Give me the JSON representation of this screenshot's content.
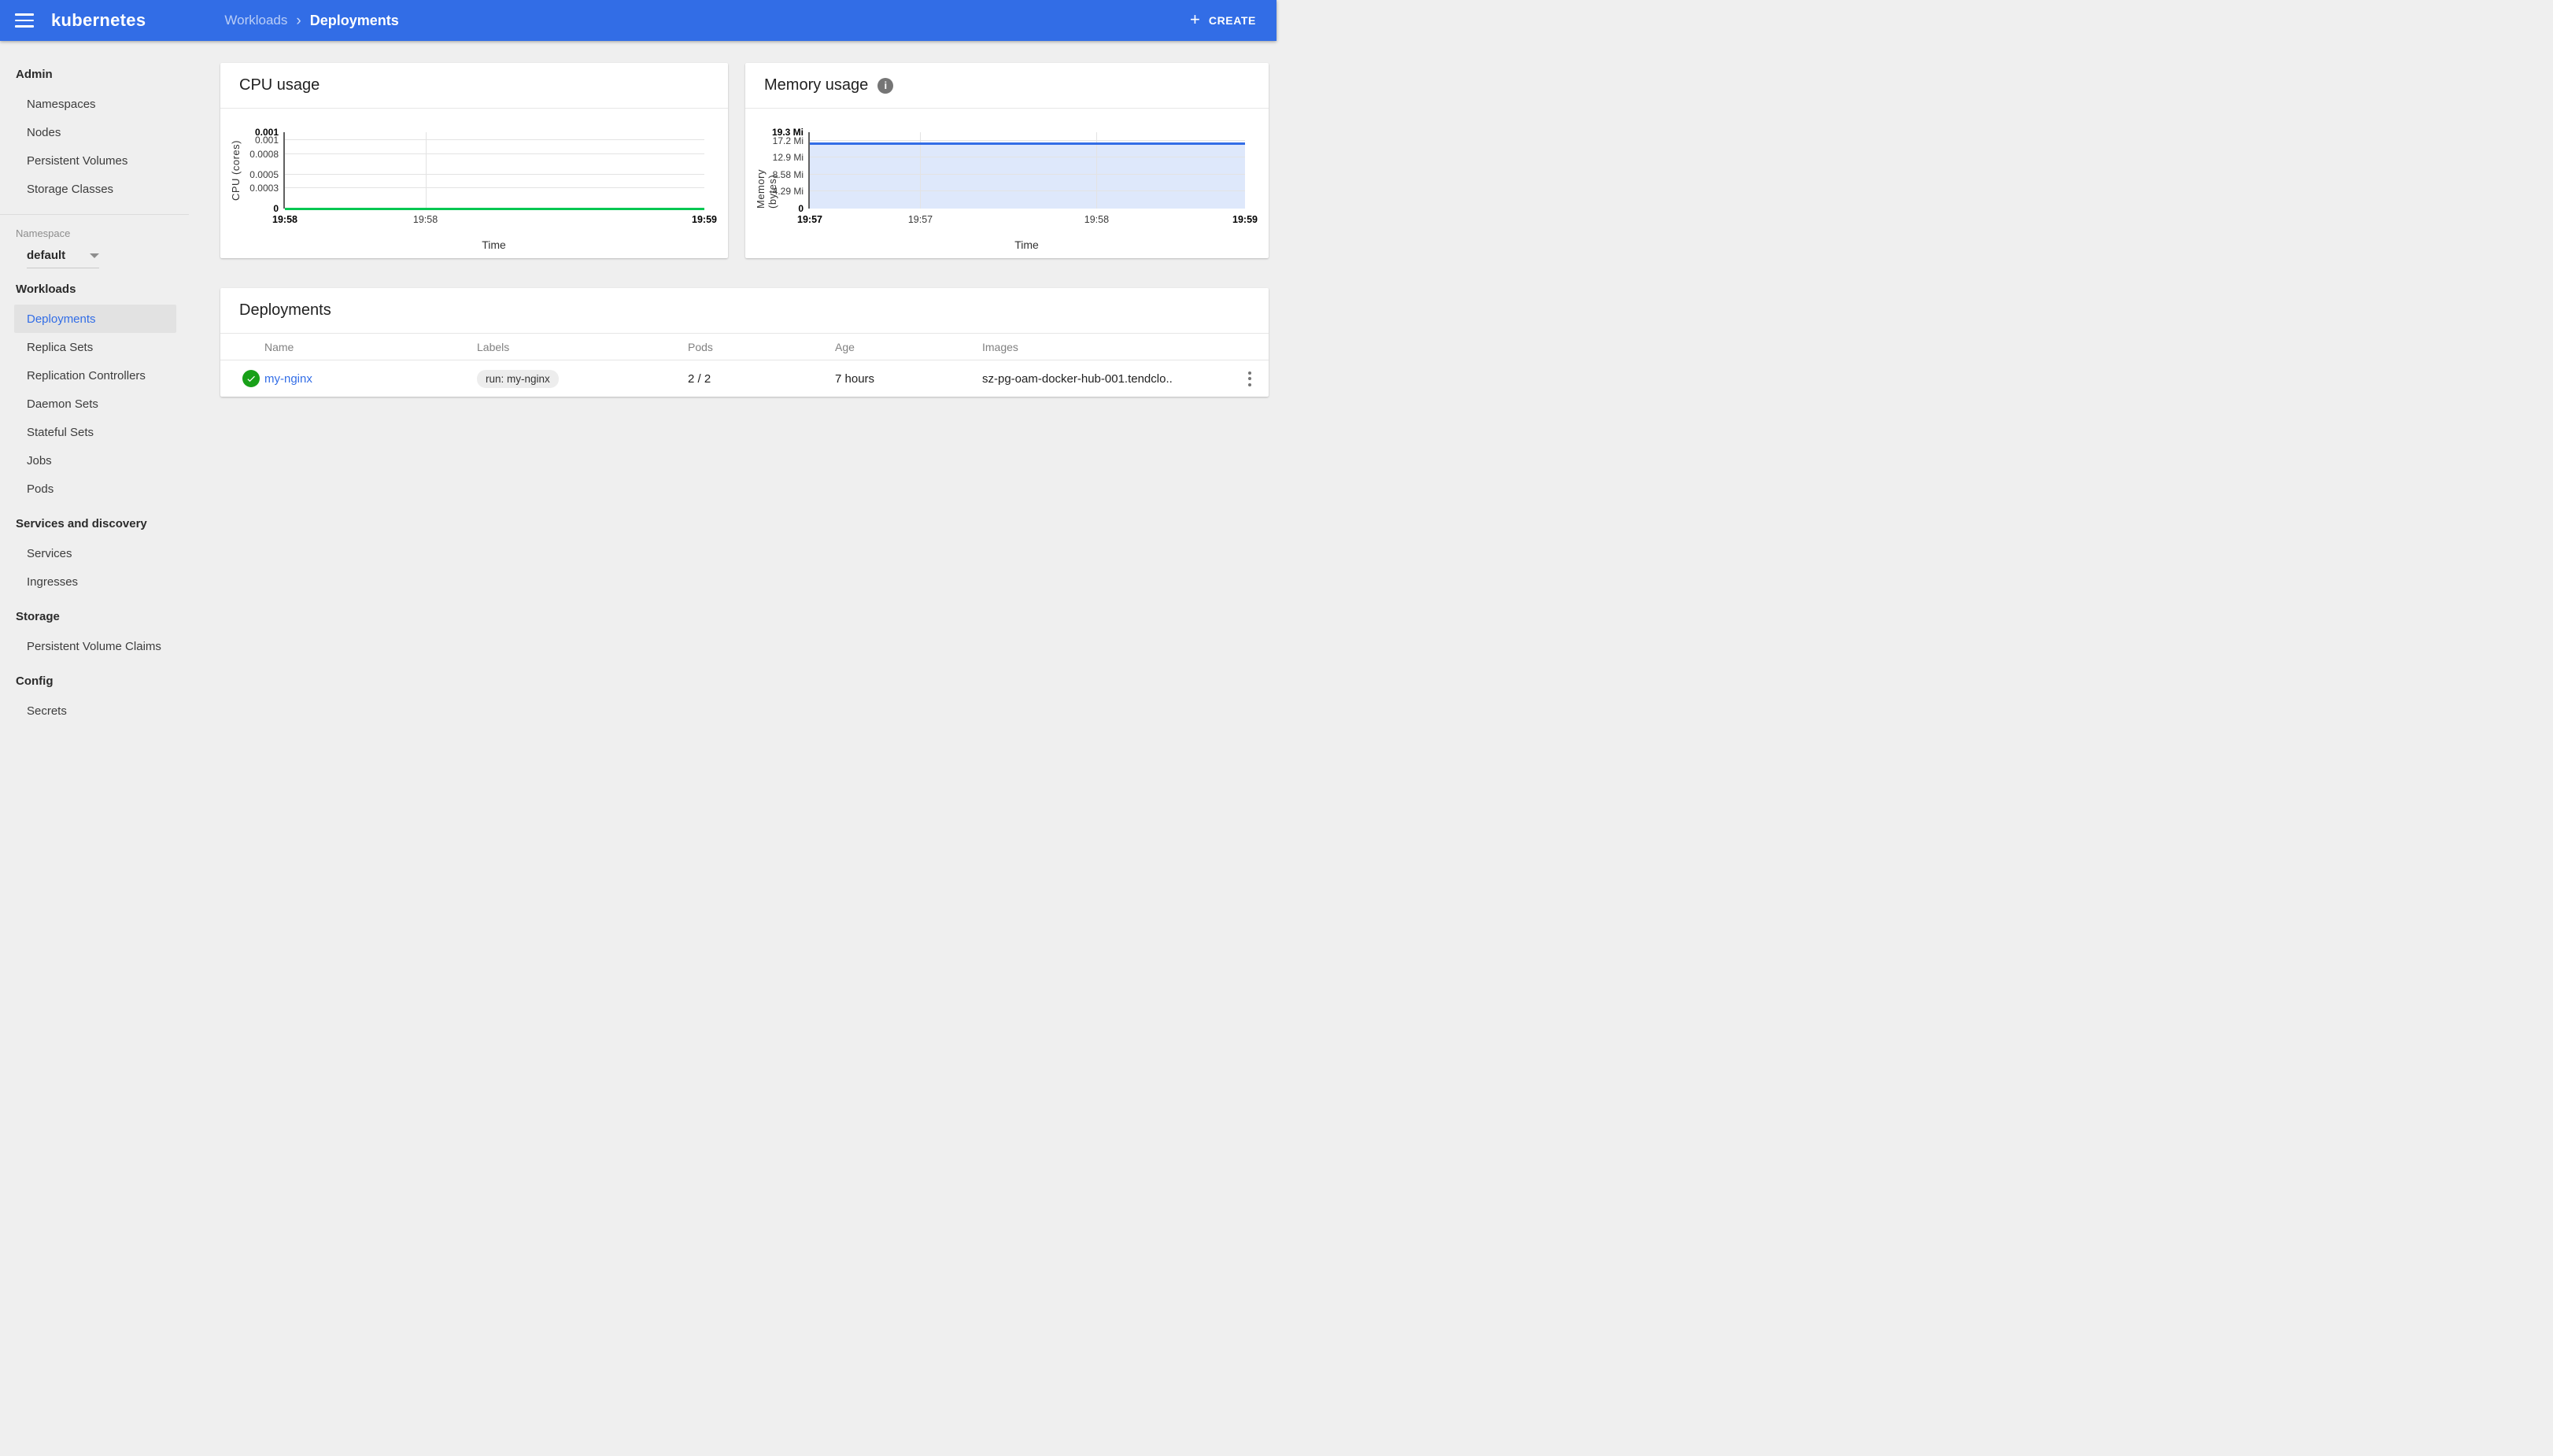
{
  "header": {
    "logo": "kubernetes",
    "breadcrumb": {
      "parent": "Workloads",
      "separator": "›",
      "current": "Deployments"
    },
    "create_label": "CREATE",
    "create_plus": "+",
    "accent_color": "#326de6"
  },
  "sidebar": {
    "sections": [
      {
        "title": "Admin",
        "items": [
          "Namespaces",
          "Nodes",
          "Persistent Volumes",
          "Storage Classes"
        ]
      },
      {
        "title": "Workloads",
        "items": [
          "Deployments",
          "Replica Sets",
          "Replication Controllers",
          "Daemon Sets",
          "Stateful Sets",
          "Jobs",
          "Pods"
        ],
        "selected": "Deployments"
      },
      {
        "title": "Services and discovery",
        "items": [
          "Services",
          "Ingresses"
        ]
      },
      {
        "title": "Storage",
        "items": [
          "Persistent Volume Claims"
        ]
      },
      {
        "title": "Config",
        "items": [
          "Secrets"
        ]
      }
    ],
    "namespace": {
      "label": "Namespace",
      "value": "default"
    }
  },
  "chart_data": [
    {
      "id": "cpu",
      "type": "line",
      "title": "CPU usage",
      "xlabel": "Time",
      "ylabel": "CPU (cores)",
      "ylim": [
        0,
        0.00112
      ],
      "grid": true,
      "y_ticks": [
        {
          "label": "0.001",
          "value": 0.00112,
          "bold": true,
          "gridline": false
        },
        {
          "label": "0.001",
          "value": 0.001,
          "bold": false,
          "gridline": true
        },
        {
          "label": "0.0008",
          "value": 0.0008,
          "bold": false,
          "gridline": true
        },
        {
          "label": "0.0005",
          "value": 0.0005,
          "bold": false,
          "gridline": true
        },
        {
          "label": "0.0003",
          "value": 0.0003,
          "bold": false,
          "gridline": true
        },
        {
          "label": "0",
          "value": 0,
          "bold": true,
          "gridline": false
        }
      ],
      "x_ticks": [
        {
          "label": "19:58",
          "pos": 0,
          "bold": true,
          "gridline": false
        },
        {
          "label": "19:58",
          "pos": 0.335,
          "bold": false,
          "gridline": true
        },
        {
          "label": "19:59",
          "pos": 1,
          "bold": true,
          "gridline": false
        }
      ],
      "series": [
        {
          "name": "CPU usage",
          "color": "#00c752",
          "fill": null,
          "value": 0,
          "unit": "cores",
          "note": "flat line at 0 cores from 19:58 to 19:59"
        }
      ]
    },
    {
      "id": "memory",
      "type": "area",
      "title": "Memory usage",
      "xlabel": "Time",
      "ylabel": "Memory (bytes)",
      "ylim": [
        0,
        19.3
      ],
      "grid": true,
      "y_ticks": [
        {
          "label": "19.3 Mi",
          "value": 19.3,
          "bold": true,
          "gridline": false
        },
        {
          "label": "17.2 Mi",
          "value": 17.2,
          "bold": false,
          "gridline": true
        },
        {
          "label": "12.9 Mi",
          "value": 12.9,
          "bold": false,
          "gridline": true
        },
        {
          "label": "8.58 Mi",
          "value": 8.58,
          "bold": false,
          "gridline": true
        },
        {
          "label": "4.29 Mi",
          "value": 4.29,
          "bold": false,
          "gridline": true
        },
        {
          "label": "0",
          "value": 0,
          "bold": true,
          "gridline": false
        }
      ],
      "x_ticks": [
        {
          "label": "19:57",
          "pos": 0,
          "bold": true,
          "gridline": false
        },
        {
          "label": "19:57",
          "pos": 0.254,
          "bold": false,
          "gridline": true
        },
        {
          "label": "19:58",
          "pos": 0.659,
          "bold": false,
          "gridline": true
        },
        {
          "label": "19:59",
          "pos": 1,
          "bold": true,
          "gridline": false
        }
      ],
      "series": [
        {
          "name": "Memory usage",
          "color": "#326de6",
          "fill": "rgba(50,109,230,0.16)",
          "value": 16.5,
          "unit": "Mi",
          "note": "flat line at ~16.5 Mi from 19:57 to 19:59"
        }
      ]
    }
  ],
  "memory_info_icon": "i",
  "deployments": {
    "title": "Deployments",
    "columns": {
      "name": "Name",
      "labels": "Labels",
      "pods": "Pods",
      "age": "Age",
      "images": "Images"
    },
    "rows": [
      {
        "status": "ok",
        "name": "my-nginx",
        "label_chip": "run: my-nginx",
        "pods": "2 / 2",
        "age": "7 hours",
        "images": "sz-pg-oam-docker-hub-001.tendclo.."
      }
    ]
  }
}
